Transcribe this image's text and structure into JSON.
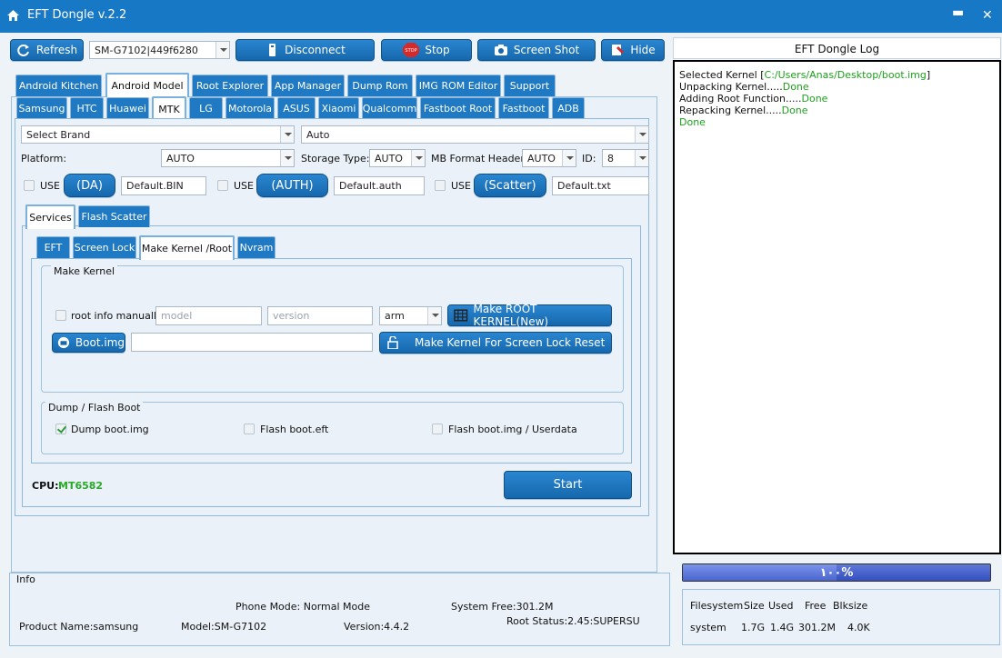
{
  "window": {
    "title": "EFT Dongle  v.2.2",
    "minimize": "▬",
    "close": "✕"
  },
  "toolbar": {
    "refresh": "Refresh",
    "device_select": "SM-G7102|449f6280",
    "disconnect": "Disconnect",
    "stop": "Stop",
    "stop_icon_text": "STOP",
    "screenshot": "Screen Shot",
    "hide": "Hide"
  },
  "main_tabs": [
    "Android Kitchen",
    "Android Model",
    "Root Explorer",
    "App Manager",
    "Dump Rom",
    "IMG ROM Editor",
    "Support"
  ],
  "brand_tabs": [
    "Samsung",
    "HTC",
    "Huawei",
    "MTK",
    "LG",
    "Motorola",
    "ASUS",
    "Xiaomi",
    "Qualcomm",
    "Fastboot Root",
    "Fastboot",
    "ADB"
  ],
  "mtk": {
    "brand_select": "Select Brand",
    "auto_select": "Auto",
    "platform_label": "Platform:",
    "platform_value": "AUTO",
    "storage_label": "Storage Type:",
    "storage_value": "AUTO",
    "mb_label": "MB Format Header",
    "mb_value": "AUTO",
    "id_label": "ID:",
    "id_value": "8",
    "use_label": "USE",
    "da_button": "(DA)",
    "da_file": "Default.BIN",
    "auth_button": "(AUTH)",
    "auth_file": "Default.auth",
    "scatter_button": "(Scatter)",
    "scatter_file": "Default.txt"
  },
  "sub_tabs": [
    "Services",
    "Flash Scatter"
  ],
  "service_tabs": [
    "EFT",
    "Screen Lock",
    "Make Kernel  /Root",
    "Nvram"
  ],
  "make_kernel": {
    "group_title": "Make Kernel",
    "root_info_label": "root info manually",
    "model_placeholder": "model",
    "version_placeholder": "version",
    "arch_value": "arm",
    "make_root_button": "Make  ROOT KERNEL(New)",
    "boot_button": "Boot.img",
    "boot_path": "",
    "reset_button": "Make Kernel For Screen Lock Reset"
  },
  "dump_flash": {
    "group_title": "Dump / Flash Boot",
    "dump_label": "Dump boot.img",
    "flash_eft_label": "Flash boot.eft",
    "flash_img_label": "Flash boot.img / Userdata"
  },
  "cpu": {
    "label": "CPU:",
    "value": "MT6582"
  },
  "start_button": "Start",
  "log": {
    "title": "EFT Dongle Log",
    "line1_pre": "Selected Kernel [",
    "line1_path": "C:/Users/Anas/Desktop/boot.img",
    "line1_post": "]",
    "line2": "Unpacking Kernel.....",
    "line3": "Adding Root Function.....",
    "line4": "Repacking Kernel.....",
    "done": "Done"
  },
  "progress": {
    "value": 1.0,
    "label": "۱۰۰%"
  },
  "info": {
    "title": "Info",
    "phone_mode": "Phone Mode: Normal Mode",
    "system_free": "System Free:301.2M",
    "product_name": "Product Name:samsung",
    "model": "Model:SM-G7102",
    "version": "Version:4.4.2",
    "root_status": "Root Status:2.45:SUPERSU"
  },
  "fs_table": {
    "headers": [
      "Filesystem",
      "Size",
      "Used",
      "Free",
      "Blksize"
    ],
    "row": [
      "system",
      "1.7G",
      "1.4G",
      "301.2M",
      "4.0K"
    ]
  },
  "colors": {
    "accent": "#1778c6",
    "ok_green": "#1fa01f",
    "cpu_green": "#2aa82a"
  }
}
